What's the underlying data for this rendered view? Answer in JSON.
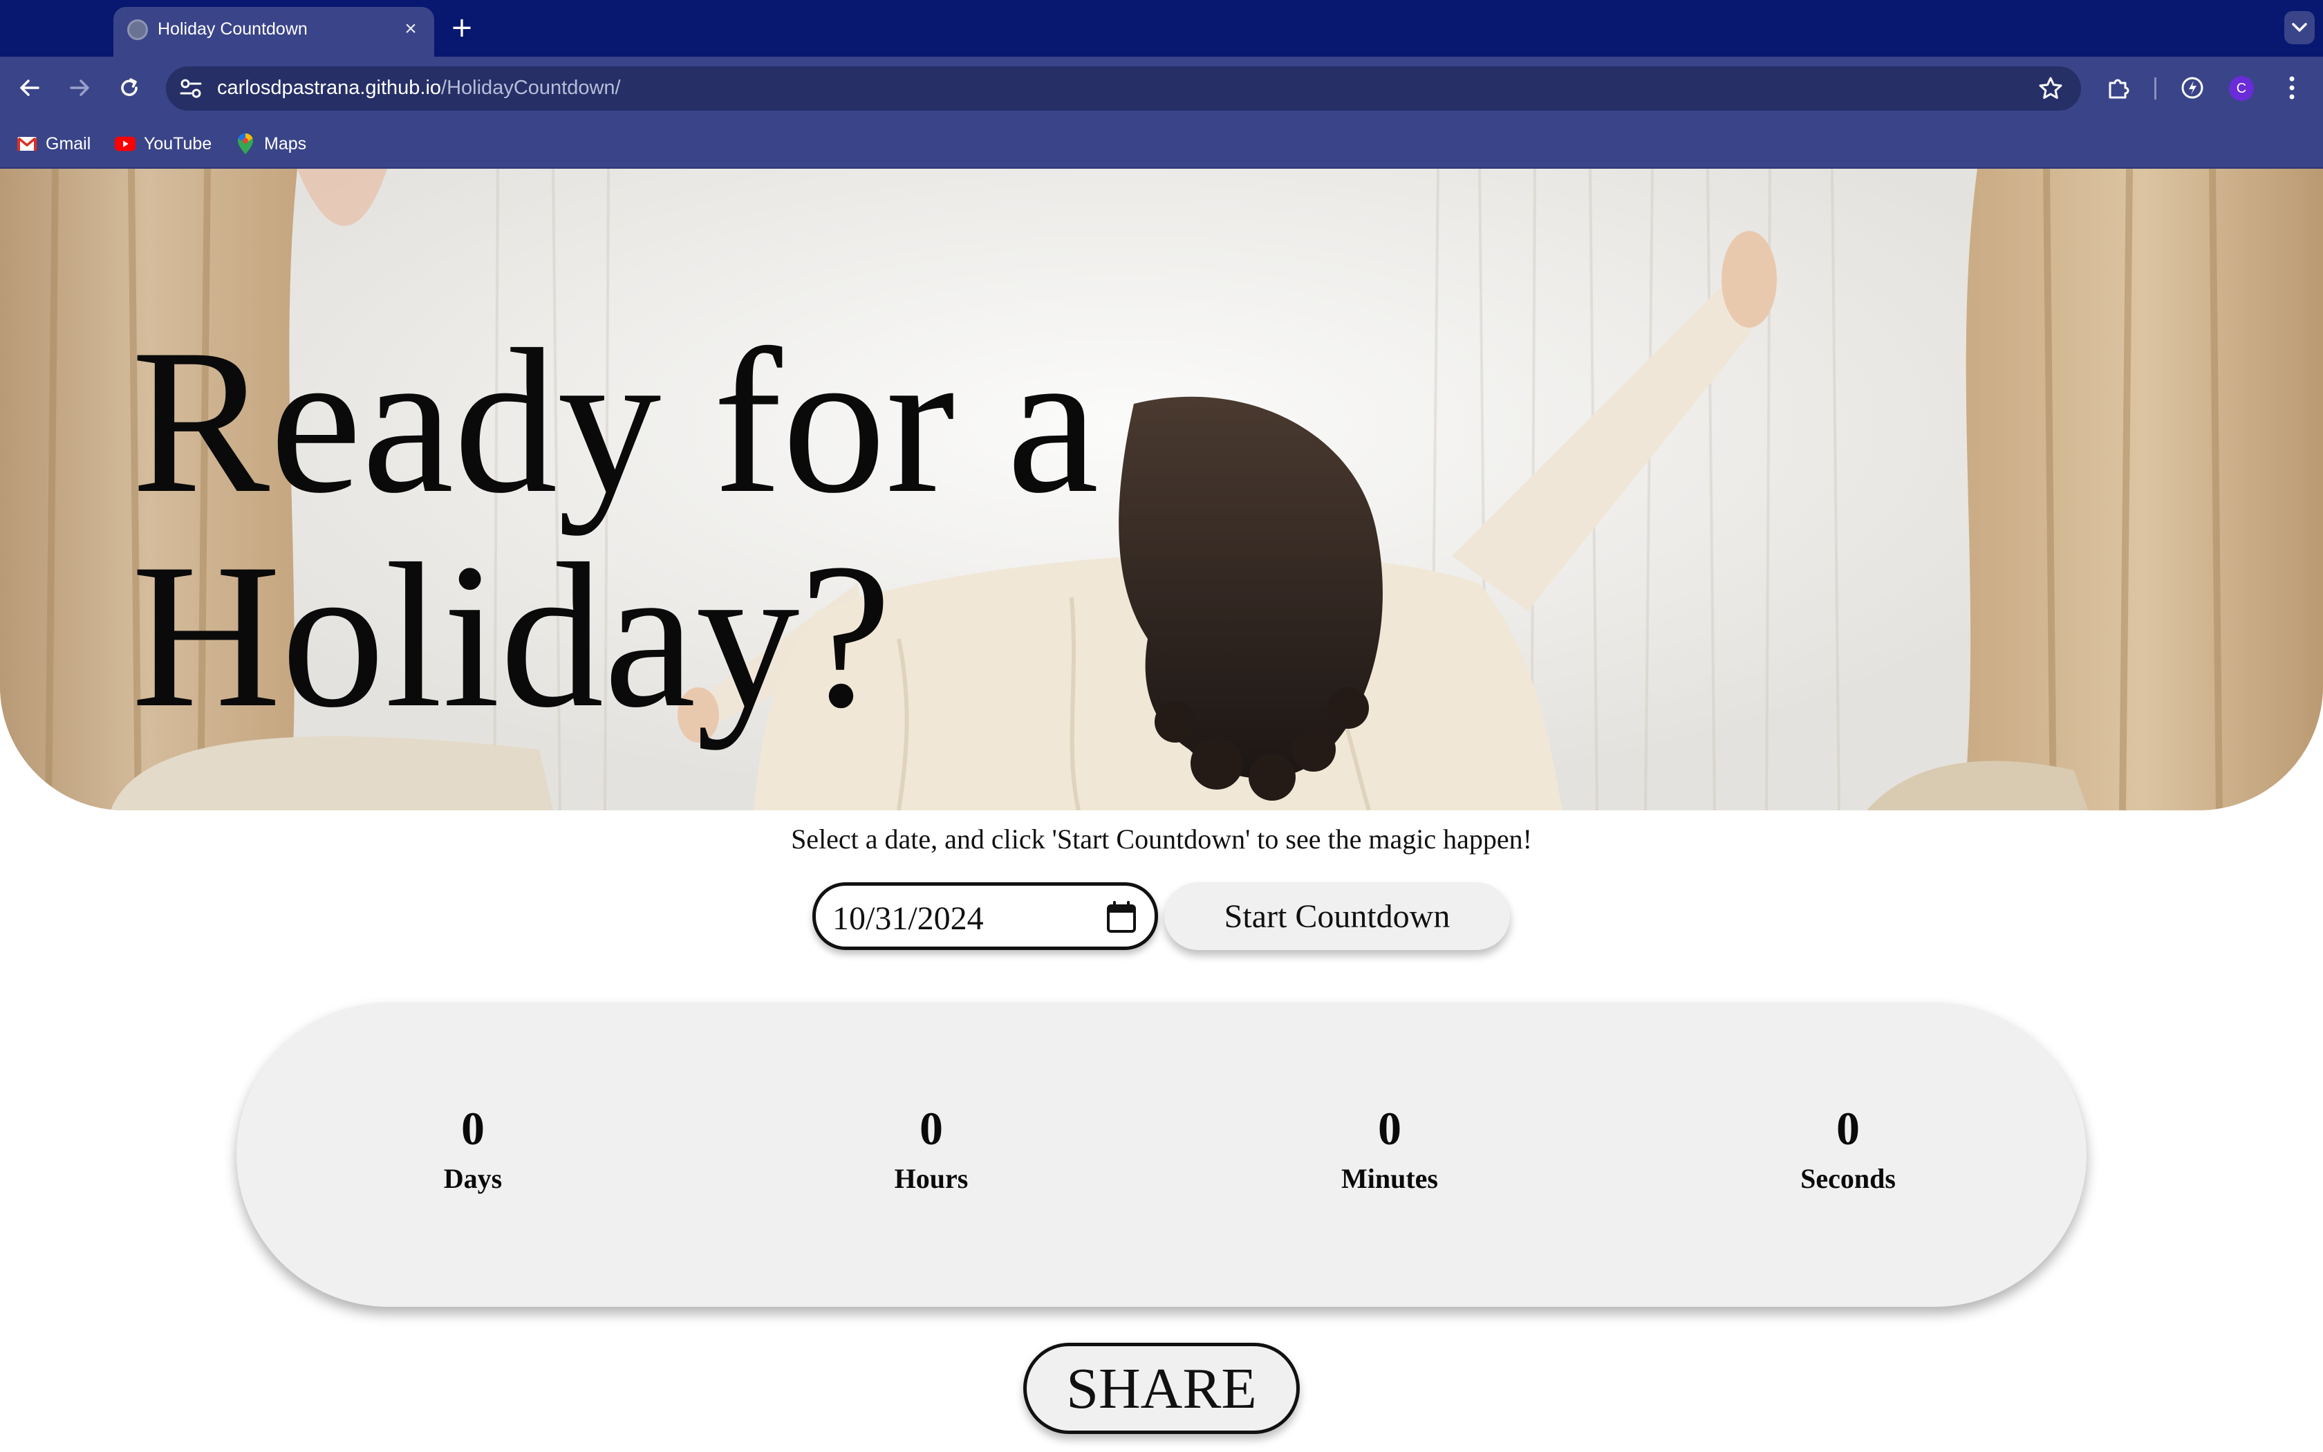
{
  "browser": {
    "tab_title": "Holiday Countdown",
    "tab_close": "×",
    "new_tab": "+",
    "url_host": "carlosdpastrana.github.io",
    "url_path": "/HolidayCountdown/",
    "profile_initial": "C",
    "bookmarks": [
      {
        "label": "Gmail",
        "icon": "gmail-icon"
      },
      {
        "label": "YouTube",
        "icon": "youtube-icon"
      },
      {
        "label": "Maps",
        "icon": "maps-icon"
      }
    ],
    "colors": {
      "tabstrip": "#081870",
      "toolbar": "#3a4488",
      "omnibox": "#262f66"
    }
  },
  "hero": {
    "title_line1": "Ready for a",
    "title_line2": "Holiday?",
    "image": "woman-stretching-by-window-photo"
  },
  "instructions": "Select a date, and click 'Start Countdown' to see the magic happen!",
  "date_input": {
    "value": "10/31/2024"
  },
  "start_button": "Start Countdown",
  "countdown": [
    {
      "value": "0",
      "label": "Days"
    },
    {
      "value": "0",
      "label": "Hours"
    },
    {
      "value": "0",
      "label": "Minutes"
    },
    {
      "value": "0",
      "label": "Seconds"
    }
  ],
  "share_button": "SHARE"
}
